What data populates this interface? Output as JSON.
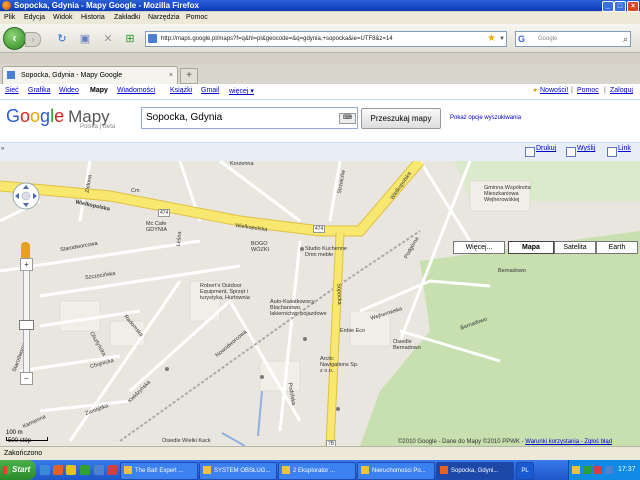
{
  "window": {
    "title": "Sopocka, Gdynia - Mapy Google - Mozilla Firefox"
  },
  "menu": [
    "Plik",
    "Edycja",
    "Widok",
    "Historia",
    "Zakładki",
    "Narzędzia",
    "Pomoc"
  ],
  "browser": {
    "url": "http://maps.google.pl/maps?f=q&hl=pl&geocode=&q=gdynia,+sopocka&ie=UTF8&z=14",
    "search_placeholder": "Google",
    "tab_title": "Sopocka, Gdynia - Mapy Google",
    "new_tab": "+"
  },
  "google_bar": {
    "left_links": [
      "Sieć",
      "Grafika",
      "Wideo",
      "Mapy",
      "Wiadomości",
      "Książki",
      "Gmail",
      "więcej ▾"
    ],
    "right_links": [
      "Nowości!",
      "Pomoc",
      "Zaloguj"
    ],
    "right_seps": [
      "|",
      "|"
    ]
  },
  "header": {
    "logo_letters": [
      "G",
      "o",
      "o",
      "g",
      "l",
      "e"
    ],
    "logo_suffix": "Mapy",
    "subtitle": "Polska | Beta",
    "query": "Sopocka, Gdynia",
    "search_button": "Przeszukaj mapy",
    "options_link": "Pokaż opcje wyszukiwania"
  },
  "link_bar": {
    "collapse": "»",
    "print": "Drukuj",
    "send": "Wyślij",
    "link": "Link"
  },
  "map": {
    "types": [
      "Więcej...",
      "Mapa",
      "Satelita",
      "Earth"
    ],
    "selected_type": "Mapa",
    "streets": [
      "Wielkopolska",
      "Wielkopolska",
      "Wielkopolska",
      "Sopocka",
      "Strzelców",
      "Starodworcowa",
      "Szczecińska",
      "Radomska",
      "Olsztyńska",
      "Chojnicka",
      "Zamojska",
      "Kamienna",
      "Starodworcowa",
      "Nowodworcowa",
      "Kwidzyńska",
      "Wejherowska",
      "Bernadowo",
      "Bernadowo",
      "Podolska",
      "Leśna",
      "Zielona",
      "Podgórna",
      "Korzenna",
      "Cm"
    ],
    "places": [
      "Mc Cafe GDYNIA",
      "BOGO WÓZKI",
      "Studio Kuchenne Dmn meble",
      "Robert's Outdoor Equipment, Sprzęt i turystyka, Hurtownia",
      "Auto-Kwiatkowscy, Blacharstwo, lakiernictwo pojazdowe",
      "Enbie Eco",
      "Osiedle Bernadowo",
      "Arctic Navigations Sp. z o.o.",
      "Gminna Wspólnota Mieszkaniowa Wejherowskiej",
      "Osiedle Wielki Kack"
    ],
    "shields": [
      "474",
      "474"
    ],
    "bottom_shield": "7B",
    "scale_labels": [
      "100 m",
      "500 stóp"
    ],
    "copyright": "©2010 Google - Dane do Mapy ©2010 PPWK - ",
    "terms_link": "Warunki korzystania - Zgłoś błąd"
  },
  "status": {
    "text": "Zakończono"
  },
  "taskbar": {
    "start": "Start",
    "tasks": [
      "The Bat! Expert ...",
      "SYSTEM OBSŁUG...",
      "2 Eksplorator ...",
      "Nieruchomości Po...",
      "Sopocka, Gdyni...",
      "PL"
    ],
    "active_index": 4,
    "clock": "17:37"
  },
  "colors": {
    "road_major": "#f8e870",
    "road_border": "#e0c040",
    "green": "#c8dfb0",
    "accent_link": "#0000cc"
  }
}
